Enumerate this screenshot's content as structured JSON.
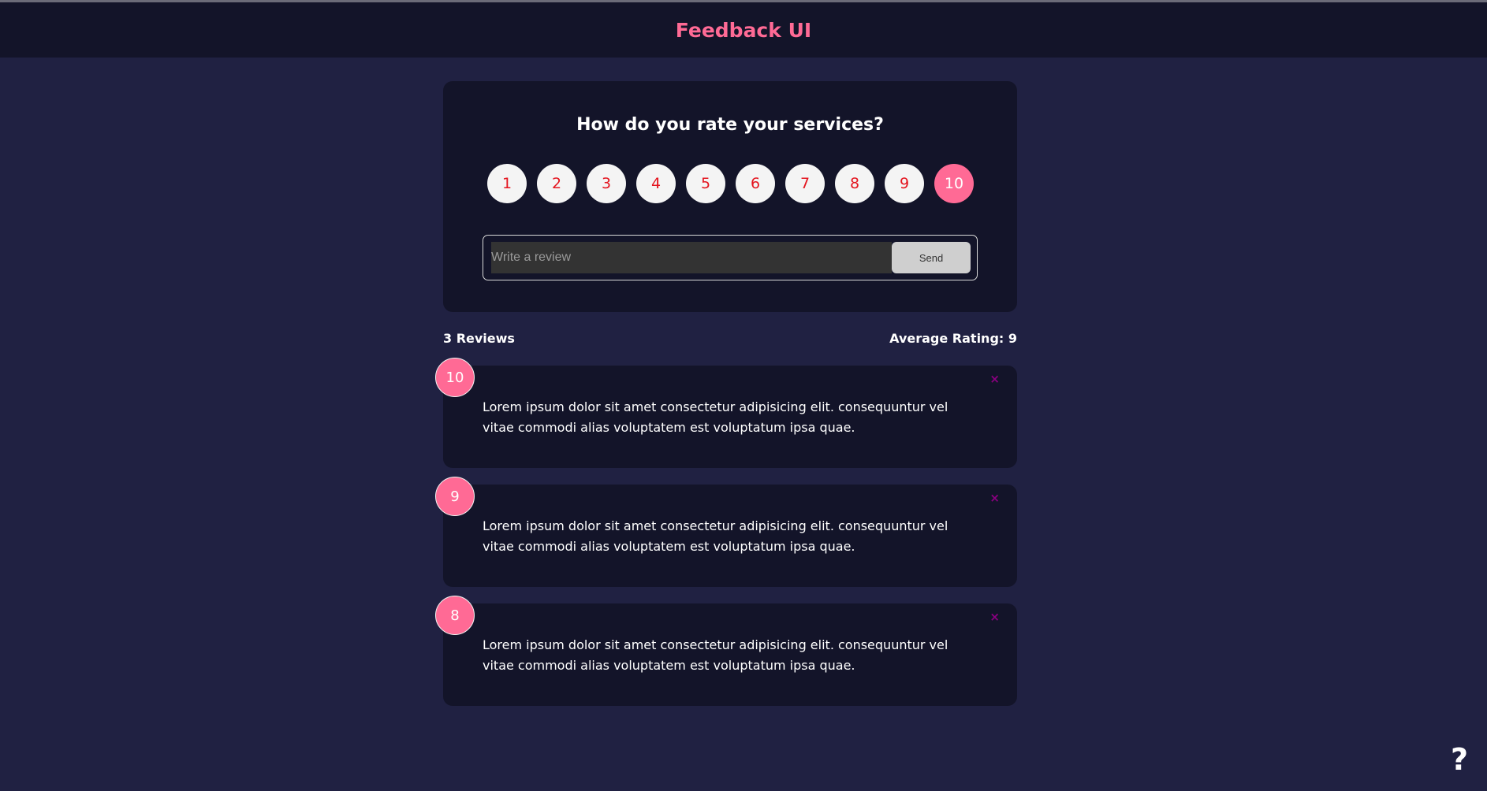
{
  "app": {
    "title": "Feedback UI"
  },
  "rating_card": {
    "question": "How do you rate your services?",
    "options": [
      "1",
      "2",
      "3",
      "4",
      "5",
      "6",
      "7",
      "8",
      "9",
      "10"
    ],
    "selected": "10",
    "placeholder": "Write a review",
    "send_label": "Send"
  },
  "stats": {
    "count_label": "3 Reviews",
    "average_label": "Average Rating: 9"
  },
  "reviews": [
    {
      "rating": "10",
      "text": "Lorem ipsum dolor sit amet consectetur adipisicing elit. consequuntur vel vitae commodi alias voluptatem est voluptatum ipsa quae.",
      "close": "×"
    },
    {
      "rating": "9",
      "text": "Lorem ipsum dolor sit amet consectetur adipisicing elit. consequuntur vel vitae commodi alias voluptatem est voluptatum ipsa quae.",
      "close": "×"
    },
    {
      "rating": "8",
      "text": "Lorem ipsum dolor sit amet consectetur adipisicing elit. consequuntur vel vitae commodi alias voluptatem est voluptatum ipsa quae.",
      "close": "×"
    }
  ],
  "help": "?",
  "colors": {
    "accent": "#ff6a95",
    "background": "#202142",
    "card": "#131429",
    "rating_text": "#e4141e",
    "close": "#8b0080"
  },
  "icons": {
    "close": "close-icon",
    "help": "help-icon"
  }
}
